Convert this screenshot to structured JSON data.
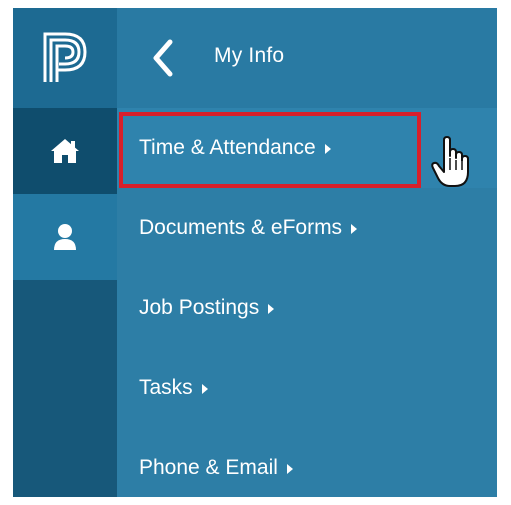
{
  "header": {
    "title": "My Info",
    "back_icon": "chevron-left-icon"
  },
  "rail": {
    "logo_icon": "powerschool-p-logo",
    "items": [
      {
        "icon": "home-icon",
        "active": true
      },
      {
        "icon": "user-icon",
        "active": false
      }
    ]
  },
  "menu": {
    "items": [
      {
        "label": "Time & Attendance",
        "highlighted": true
      },
      {
        "label": "Documents & eForms",
        "highlighted": false
      },
      {
        "label": "Job Postings",
        "highlighted": false
      },
      {
        "label": "Tasks",
        "highlighted": false
      },
      {
        "label": "Phone & Email",
        "highlighted": false
      }
    ]
  },
  "colors": {
    "rail": "#17587a",
    "panel": "#2d7ea6",
    "highlight": "#d71f2b",
    "text": "#ffffff"
  },
  "cursor_icon": "hand-pointer-icon"
}
